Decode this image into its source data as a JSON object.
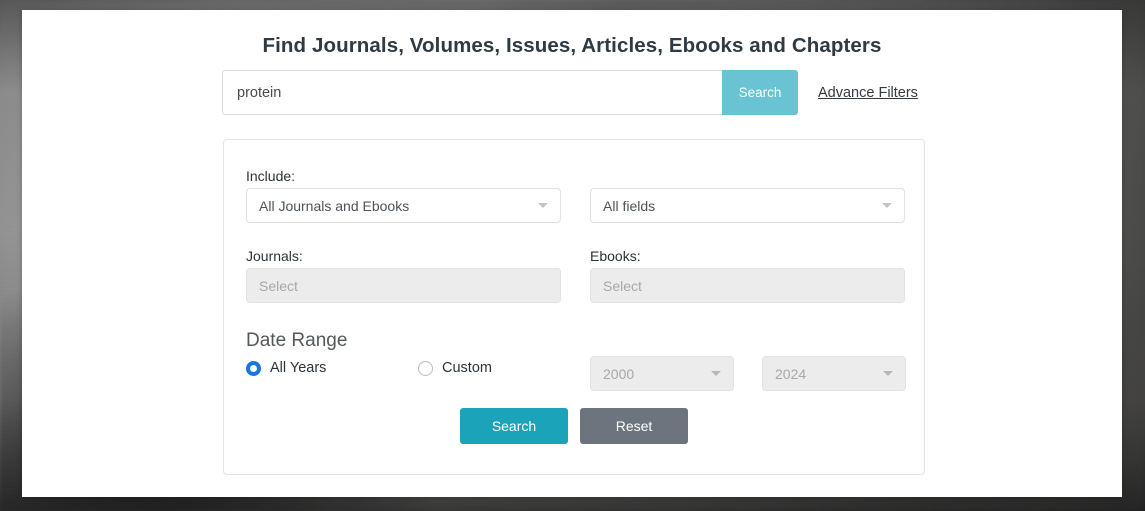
{
  "page": {
    "title": "Find Journals, Volumes, Issues, Articles, Ebooks and Chapters"
  },
  "search_bar": {
    "query_value": "protein",
    "query_placeholder": "",
    "search_label": "Search",
    "advance_filters_label": "Advance Filters"
  },
  "filters": {
    "include_label": "Include:",
    "include_select_value": "All Journals and Ebooks",
    "fields_select_value": "All fields",
    "journals_label": "Journals:",
    "journals_placeholder": "Select",
    "ebooks_label": "Ebooks:",
    "ebooks_placeholder": "Select",
    "date_range_title": "Date Range",
    "all_years_label": "All Years",
    "custom_label": "Custom",
    "year_from_value": "2000",
    "year_to_value": "2024",
    "search_label": "Search",
    "reset_label": "Reset"
  },
  "colors": {
    "top_search_btn": "#69c3d2",
    "primary_search_btn": "#1ba3b9",
    "reset_btn": "#6c757d",
    "radio_selected": "#1a73e8",
    "panel_bg": "#ffffff",
    "disabled_field": "#ececec"
  }
}
